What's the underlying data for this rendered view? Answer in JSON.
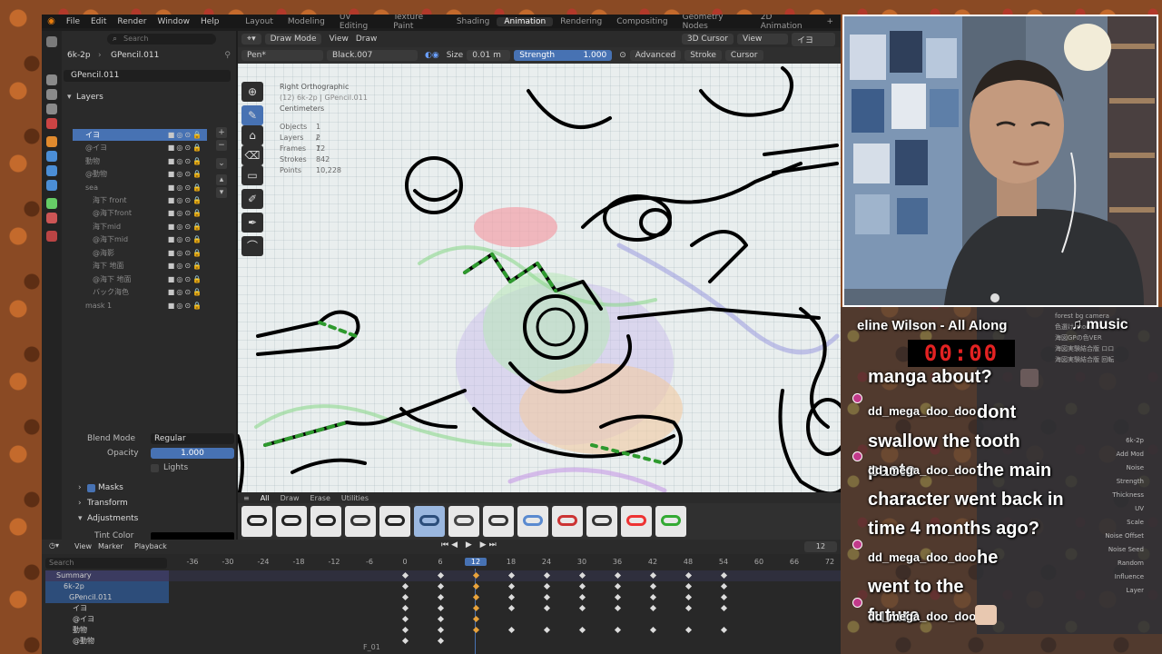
{
  "blender": {
    "menus": [
      "File",
      "Edit",
      "Render",
      "Window",
      "Help"
    ],
    "workspaces": [
      "Layout",
      "Modeling",
      "UV Editing",
      "Texture Paint",
      "Shading",
      "Animation",
      "Rendering",
      "Compositing",
      "Geometry Nodes",
      "2D Animation"
    ],
    "active_workspace": "Animation",
    "add_workspace": "+",
    "properties": {
      "search_placeholder": "Search",
      "breadcrumb_scene": "6k-2p",
      "breadcrumb_object": "GPencil.011",
      "data_name": "GPencil.011",
      "layers_label": "Layers",
      "layers": [
        "イヨ",
        "@イヨ",
        "動物",
        "@動物",
        "sea",
        "海下 front",
        "@海下front",
        "海下mid",
        "@海下mid",
        "@海影",
        "海下 地面",
        "@海下 地面",
        "バック海色",
        "mask 1"
      ],
      "selected_layer": "イヨ",
      "blend_mode_label": "Blend Mode",
      "blend_mode_value": "Regular",
      "opacity_label": "Opacity",
      "opacity_value": "1.000",
      "lights_label": "Lights",
      "masks_label": "Masks",
      "transform_label": "Transform",
      "adjustments_label": "Adjustments",
      "tint_color_label": "Tint Color"
    },
    "viewport": {
      "mode": "Draw Mode",
      "view_menu": "View",
      "draw_menu": "Draw",
      "cursor_menu": "3D Cursor",
      "view_dropdown": "View",
      "layer_dropdown": "イヨ",
      "brush": "Pen*",
      "material": "Black.007",
      "size_label": "Size",
      "size_value": "0.01 m",
      "strength_label": "Strength",
      "strength_value": "1.000",
      "advanced": "Advanced",
      "stroke": "Stroke",
      "cursor": "Cursor",
      "view_name": "Right Orthographic",
      "view_sub": "(12) 6k-2p | GPencil.011",
      "units": "Centimeters",
      "stats": [
        {
          "label": "Objects",
          "value": "1 / 7"
        },
        {
          "label": "Layers",
          "value": "2"
        },
        {
          "label": "Frames",
          "value": "12"
        },
        {
          "label": "Strokes",
          "value": "842"
        },
        {
          "label": "Points",
          "value": "10,228"
        }
      ]
    },
    "brush_tabs": [
      "All",
      "Draw",
      "Erase",
      "Utilities"
    ],
    "timeline": {
      "view": "View",
      "marker": "Marker",
      "playback": "Playback",
      "current_frame": "12",
      "search_placeholder": "Search",
      "ruler": [
        "-36",
        "-30",
        "-24",
        "-18",
        "-12",
        "-6",
        "0",
        "6",
        "12",
        "18",
        "24",
        "30",
        "36",
        "42",
        "48",
        "54",
        "60",
        "66",
        "72"
      ],
      "channels": [
        "Summary",
        "6k-2p",
        "GPencil.011",
        "イヨ",
        "@イヨ",
        "動物",
        "@動物"
      ],
      "frame_label": "F_01"
    }
  },
  "stream": {
    "now_playing": "eline Wilson - All Along",
    "music_label": "♫ music",
    "timer": "00:00",
    "messages": [
      {
        "user": "",
        "text": "manga about?"
      },
      {
        "user": "dd_mega_doo_doo",
        "text": "dont swallow the tooth paste"
      },
      {
        "user": "dd_mega_doo_doo",
        "text": "the main character went back in time 4 months ago?"
      },
      {
        "user": "dd_mega_doo_doo",
        "text": "he went to the future"
      },
      {
        "user": "dd_mega_doo_doo",
        "text": ""
      }
    ],
    "bg_panel_labels": [
      "forest bg camera",
      "色選け modifile",
      "海図GPの色VER",
      "海図実験結合版 ロロ",
      "海図実験結合版 回転"
    ],
    "bg_panel_right": [
      "6k-2p",
      "Add Mod",
      "Noise",
      "Strength",
      "Thickness",
      "UV",
      "Scale",
      "Noise Offset",
      "Noise Seed",
      "Random",
      "Influence",
      "Layer"
    ]
  },
  "colors": {
    "accent": "#4772b3",
    "strength_bar": "#4772b3",
    "timer_red": "#e32222",
    "chat_dot": "#c23a8a"
  }
}
